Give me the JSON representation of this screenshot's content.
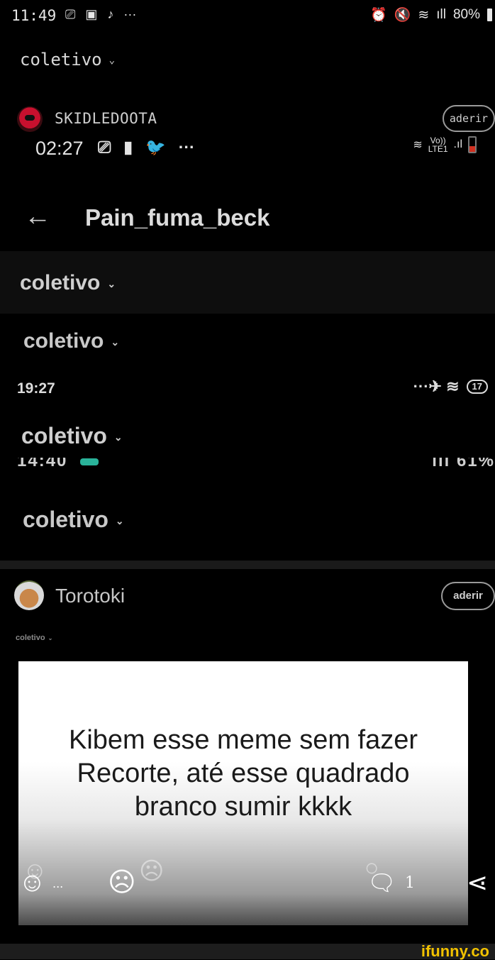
{
  "layer1": {
    "status": {
      "time": "11:49",
      "left_icons": [
        "twitch-icon",
        "gallery-icon",
        "tiktok-icon",
        "more-icon"
      ],
      "left_glyphs": [
        "⎚",
        "▣",
        "♪",
        "···"
      ],
      "right_glyphs": [
        "⏰",
        "🔇",
        "≋",
        "ıll"
      ],
      "battery": "80%"
    },
    "community": "coletivo",
    "author": {
      "name": "SKIDLEDOOTA",
      "join_label": "aderir"
    }
  },
  "layer2": {
    "status": {
      "time": "02:27",
      "left_glyphs": [
        "⎚",
        "▮",
        "🐦",
        "···"
      ],
      "lte_top": "Vo))",
      "lte_bottom": "LTE1",
      "signal": ".ıl"
    },
    "title": "Pain_fuma_beck",
    "community_a": "coletivo",
    "community_b": "coletivo"
  },
  "layer3": {
    "status": {
      "time": "19:27",
      "right_glyphs": "···✈ ≋",
      "battery": "17"
    },
    "community": "coletivo",
    "cut_left": "14:40",
    "cut_right": "ıll 61%",
    "community_b": "coletivo"
  },
  "post": {
    "author": {
      "name": "Torotoki",
      "join_label": "aderir"
    },
    "community": "coletivo",
    "meme_lines": [
      "Kibem esse meme sem fazer",
      "Recorte, até esse quadrado",
      "branco sumir kkkk"
    ],
    "reactions": {
      "like_glyph": "☺",
      "dots": "...",
      "sad_glyph": "☹",
      "comment_glyph": "🗨",
      "comment_count": "1",
      "share_glyph": "⋖"
    }
  },
  "watermark": "ifunny.co",
  "colors": {
    "background": "#000000",
    "watermark": "#f2c200",
    "badge_teal": "#2ab39a",
    "avatar_red": "#c8102e"
  }
}
